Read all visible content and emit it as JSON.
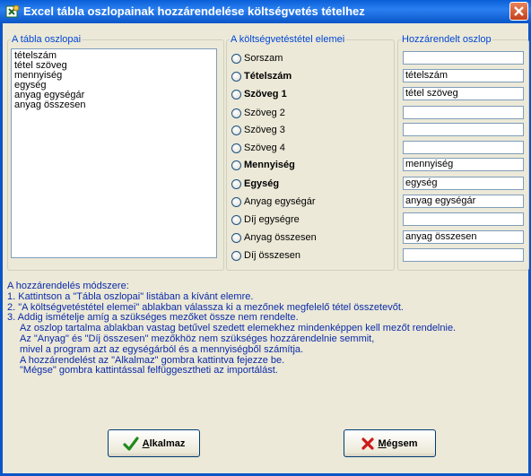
{
  "window": {
    "title": "Excel tábla oszlopainak hozzárendelése költségvetés tételhez",
    "close_icon": "close-icon",
    "app_icon": "excel-app-icon"
  },
  "groups": {
    "table_columns": "A tábla oszlopai",
    "item_elements": "A költségvetéstétel elemei",
    "assigned_column": "Hozzárendelt oszlop"
  },
  "table_columns": [
    "tételszám",
    "tétel szöveg",
    "mennyiség",
    "egység",
    "anyag egységár",
    "anyag összesen"
  ],
  "elements": [
    {
      "label": "Sorszam",
      "bold": false,
      "value": ""
    },
    {
      "label": "Tételszám",
      "bold": true,
      "value": "tételszám"
    },
    {
      "label": "Szöveg 1",
      "bold": true,
      "value": "tétel szöveg"
    },
    {
      "label": "Szöveg 2",
      "bold": false,
      "value": ""
    },
    {
      "label": "Szöveg 3",
      "bold": false,
      "value": ""
    },
    {
      "label": "Szöveg 4",
      "bold": false,
      "value": ""
    },
    {
      "label": "Mennyiség",
      "bold": true,
      "value": "mennyiség"
    },
    {
      "label": "Egység",
      "bold": true,
      "value": "egység"
    },
    {
      "label": "Anyag egységár",
      "bold": false,
      "value": "anyag egységár"
    },
    {
      "label": "Díj egységre",
      "bold": false,
      "value": ""
    },
    {
      "label": "Anyag összesen",
      "bold": false,
      "value": "anyag összesen"
    },
    {
      "label": "Díj összesen",
      "bold": false,
      "value": ""
    }
  ],
  "help": {
    "line1": "A hozzárendelés módszere:",
    "line2": "1. Kattintson a \"Tábla oszlopai\" listában a kívánt elemre.",
    "line3": "2. \"A költségvetéstétel elemei\" ablakban válassza ki a mezőnek megfelelő tétel összetevőt.",
    "line4": "3. Addig ismételje amíg a szükséges mezőket össze nem rendelte.",
    "line5": "Az oszlop tartalma ablakban vastag betűvel szedett elemekhez mindenképpen kell mezőt rendelnie.",
    "line6": "Az \"Anyag\" és \"Díj összesen\" mezőkhöz nem szükséges hozzárendelnie semmit,",
    "line7": "mivel a program azt az egységárból és a mennyiségből számítja.",
    "line8": "A hozzárendelést az \"Alkalmaz\" gombra kattintva fejezze be.",
    "line9": "\"Mégse\" gombra kattintással felfüggesztheti az importálást."
  },
  "buttons": {
    "apply_first": "A",
    "apply_rest": "lkalmaz",
    "cancel_first": "M",
    "cancel_rest": "égsem",
    "apply_icon": "checkmark-icon",
    "cancel_icon": "x-mark-icon"
  },
  "colors": {
    "title_bar": "#0a5fd8",
    "group_legend": "#0046d5",
    "help_text": "#0a2aa8",
    "dialog_bg": "#ece9d8"
  }
}
